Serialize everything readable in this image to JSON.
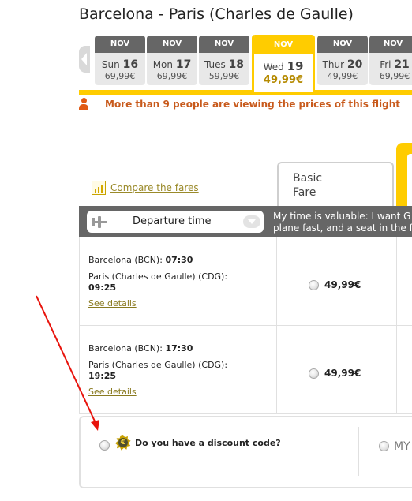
{
  "route": {
    "title": "Barcelona - Paris (Charles de Gaulle)"
  },
  "date_tabs": [
    {
      "month": "NOV",
      "weekday": "Sun",
      "day": "16",
      "price": "69,99€",
      "selected": false
    },
    {
      "month": "NOV",
      "weekday": "Mon",
      "day": "17",
      "price": "69,99€",
      "selected": false
    },
    {
      "month": "NOV",
      "weekday": "Tues",
      "day": "18",
      "price": "59,99€",
      "selected": false
    },
    {
      "month": "NOV",
      "weekday": "Wed",
      "day": "19",
      "price": "49,99€",
      "selected": true
    },
    {
      "month": "NOV",
      "weekday": "Thur",
      "day": "20",
      "price": "49,99€",
      "selected": false
    },
    {
      "month": "NOV",
      "weekday": "Fri",
      "day": "21",
      "price": "69,99€",
      "selected": false
    }
  ],
  "notice": {
    "viewers": "More than 9 people are viewing the prices of this flight"
  },
  "fares": {
    "compare_link": "Compare the fares",
    "basic_fare_label": "Basic Fare"
  },
  "sort": {
    "selected": "Departure time",
    "promo_text_line1": "My time is valuable: I want G",
    "promo_text_line2": "plane fast, and a seat in the fr"
  },
  "flights": [
    {
      "origin_label": "Barcelona (BCN):",
      "departure_time": "07:30",
      "destination_label": "Paris (Charles de Gaulle) (CDG):",
      "arrival_time": "09:25",
      "details_link": "See details",
      "basic_price": "49,99€"
    },
    {
      "origin_label": "Barcelona (BCN):",
      "departure_time": "17:30",
      "destination_label": "Paris (Charles de Gaulle) (CDG):",
      "arrival_time": "19:25",
      "details_link": "See details",
      "basic_price": "49,99€"
    }
  ],
  "discount": {
    "badge_symbol": "€",
    "question": "Do you have a discount code?",
    "my_label": "MY"
  },
  "colors": {
    "brand_yellow": "#ffcc00",
    "header_gray": "#666666",
    "notice_orange": "#c85a1c",
    "annotation_red": "#e8130c"
  }
}
